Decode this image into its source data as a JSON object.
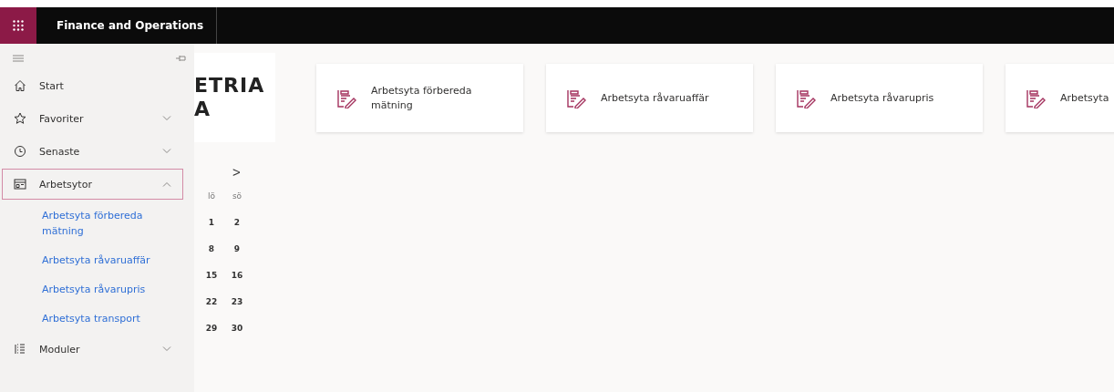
{
  "app_bar": {
    "title": "Finance and Operations"
  },
  "nav": {
    "items": [
      {
        "kind": "item",
        "label": "Start",
        "selected": false
      },
      {
        "kind": "group",
        "label": "Favoriter",
        "selected": false,
        "expanded": false
      },
      {
        "kind": "group",
        "label": "Senaste",
        "selected": false,
        "expanded": false
      },
      {
        "kind": "group",
        "label": "Arbetsytor",
        "selected": true,
        "expanded": true,
        "children": [
          {
            "label": "Arbetsyta förbereda mätning"
          },
          {
            "label": "Arbetsyta råvaruaffär"
          },
          {
            "label": "Arbetsyta råvarupris"
          },
          {
            "label": "Arbetsyta transport"
          }
        ]
      },
      {
        "kind": "group",
        "label": "Moduler",
        "selected": false,
        "expanded": false
      }
    ]
  },
  "logo": {
    "lines": [
      "ETRIA",
      "A"
    ]
  },
  "calendar": {
    "next": ">",
    "days": [
      "lö",
      "sö"
    ],
    "weeks": [
      [
        "1",
        "2"
      ],
      [
        "8",
        "9"
      ],
      [
        "15",
        "16"
      ],
      [
        "22",
        "23"
      ],
      [
        "29",
        "30"
      ]
    ]
  },
  "tiles": [
    {
      "label": "Arbetsyta förbereda mätning"
    },
    {
      "label": "Arbetsyta råvaruaffär"
    },
    {
      "label": "Arbetsyta råvarupris"
    },
    {
      "label": "Arbetsyta"
    }
  ]
}
